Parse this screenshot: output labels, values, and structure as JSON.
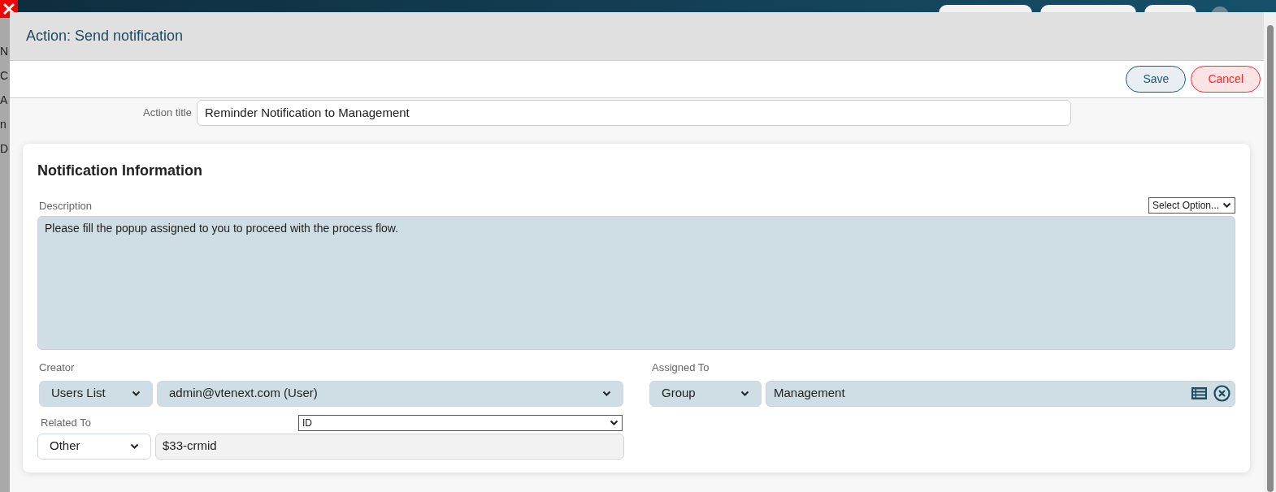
{
  "background_page": {
    "left_labels": [
      "N",
      "C",
      "A",
      "n",
      "D"
    ]
  },
  "dialog": {
    "title": "Action: Send notification",
    "buttons": [
      {
        "label": "Save",
        "kind": "primary"
      },
      {
        "label": "Cancel",
        "kind": "danger"
      }
    ],
    "action_title": {
      "label": "Action title",
      "value": "Reminder Notification to Management"
    },
    "section": {
      "title": "Notification Information",
      "description": {
        "label": "Description",
        "option_select": "Select Option...",
        "value": "Please fill the popup assigned to you to proceed with the process flow."
      },
      "creator": {
        "label": "Creator",
        "type": "Users List",
        "value": "admin@vtenext.com (User)"
      },
      "assigned_to": {
        "label": "Assigned To",
        "type": "Group",
        "value": "Management"
      },
      "related_to": {
        "label": "Related To",
        "field_select": "ID",
        "type": "Other",
        "value": "$33-crmid"
      }
    }
  }
}
